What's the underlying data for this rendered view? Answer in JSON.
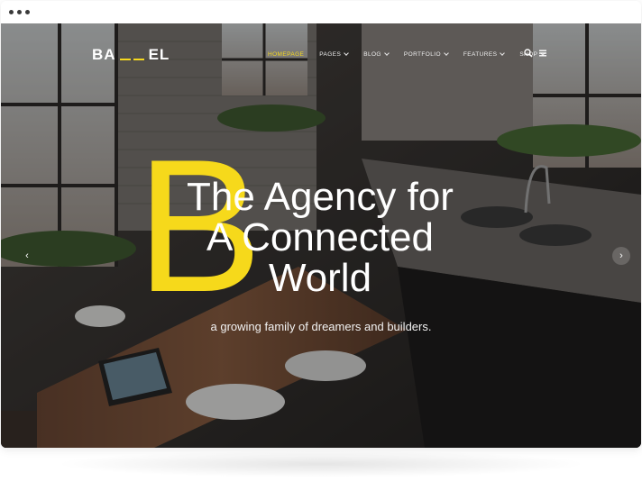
{
  "window": {
    "dots": [
      "dot",
      "dot",
      "dot"
    ]
  },
  "header": {
    "logo": {
      "left": "BA",
      "right": "EL"
    },
    "nav": [
      {
        "label": "HOMEPAGE",
        "active": true,
        "dropdown": false
      },
      {
        "label": "PAGES",
        "active": false,
        "dropdown": true
      },
      {
        "label": "BLOG",
        "active": false,
        "dropdown": true
      },
      {
        "label": "PORTFOLIO",
        "active": false,
        "dropdown": true
      },
      {
        "label": "FEATURES",
        "active": false,
        "dropdown": true
      },
      {
        "label": "SHOP",
        "active": false,
        "dropdown": true
      }
    ],
    "icons": [
      "search-icon",
      "menu-icon"
    ]
  },
  "hero": {
    "big_letter": "B",
    "headline_lines": [
      "The Agency for",
      "A Connected",
      "World"
    ],
    "tagline": "a growing family of dreamers and builders.",
    "prev_arrow": "‹",
    "next_arrow": "›"
  },
  "colors": {
    "accent": "#f6d91b",
    "text": "#ffffff"
  }
}
